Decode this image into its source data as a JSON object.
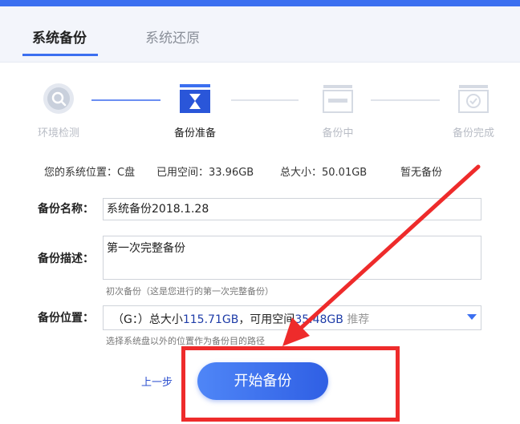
{
  "tabs": [
    {
      "label": "系统备份",
      "active": true
    },
    {
      "label": "系统还原",
      "active": false
    }
  ],
  "steps": [
    {
      "label": "环境检测",
      "state": "done",
      "icon": "magnifier-icon"
    },
    {
      "label": "备份准备",
      "state": "active",
      "icon": "hourglass-icon"
    },
    {
      "label": "备份中",
      "state": "pending",
      "icon": "progress-icon"
    },
    {
      "label": "备份完成",
      "state": "pending",
      "icon": "check-shield-icon"
    }
  ],
  "info": {
    "location": "您的系统位置：C盘",
    "used": "已用空间：33.96GB",
    "total": "总大小：50.01GB",
    "status": "暂无备份"
  },
  "form": {
    "name_label": "备份名称：",
    "name_value": "系统备份2018.1.28",
    "desc_label": "备份描述：",
    "desc_value": "第一次完整备份",
    "desc_hint": "初次备份（这是您进行的第一次完整备份）",
    "loc_label": "备份位置：",
    "loc_drive": "（G：）总大小",
    "loc_total": "115.71GB",
    "loc_free_label": "，可用空间",
    "loc_free": "35.48GB",
    "loc_recommend": "推荐",
    "loc_hint": "选择系统盘以外的位置作为备份目的路径"
  },
  "actions": {
    "prev": "上一步",
    "start": "开始备份"
  },
  "colors": {
    "accent": "#3b6ff0",
    "highlight": "#ee2b2b"
  }
}
